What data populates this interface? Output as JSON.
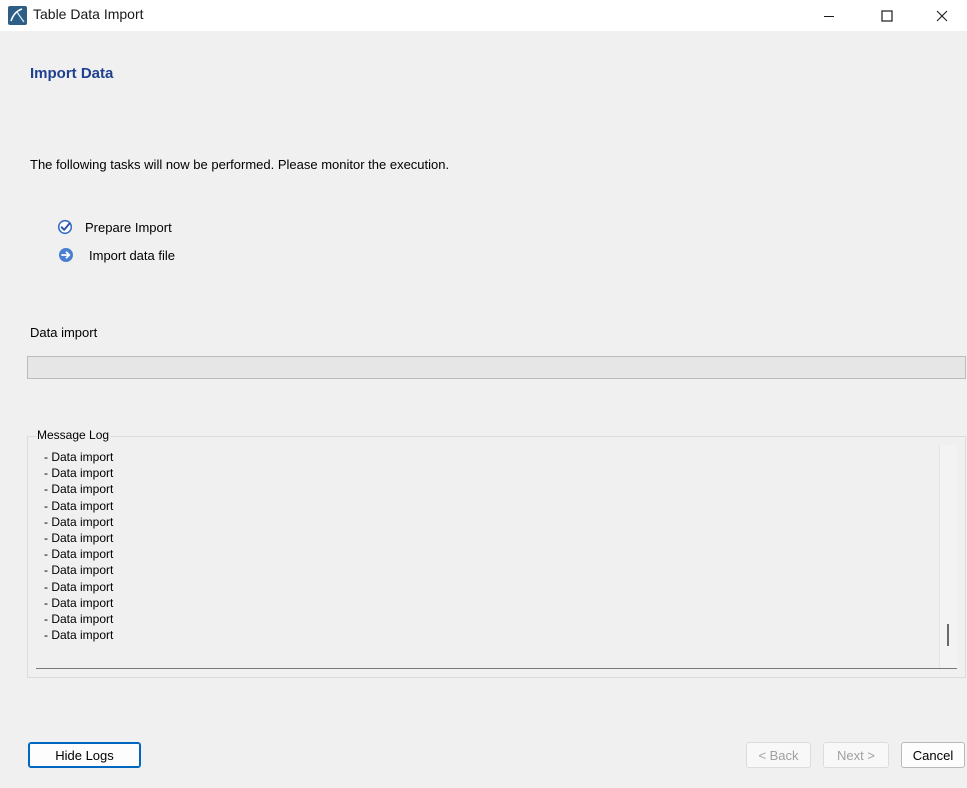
{
  "window": {
    "title": "Table Data Import",
    "app_icon": "mysql-workbench-icon",
    "controls": [
      "minimize-icon",
      "maximize-icon",
      "close-icon"
    ]
  },
  "page": {
    "heading": "Import Data",
    "intro": "The following tasks will now be performed. Please monitor the execution.",
    "tasks": [
      {
        "label": "Prepare Import",
        "status": "done",
        "icon": "check-circle-icon"
      },
      {
        "label": "Import data file",
        "status": "in-progress",
        "icon": "arrow-right-circle-icon"
      }
    ]
  },
  "progress": {
    "label": "Data import",
    "value_percent": 0
  },
  "log": {
    "title": "Message Log",
    "lines": [
      "- Data import",
      "- Data import",
      "- Data import",
      "- Data import",
      "- Data import",
      "- Data import",
      "- Data import",
      "- Data import",
      "- Data import",
      "- Data import",
      "- Data import",
      "- Data import"
    ]
  },
  "buttons": {
    "hide_logs": "Hide Logs",
    "back": "< Back",
    "next": "Next >",
    "cancel": "Cancel"
  },
  "colors": {
    "heading": "#1f3f8f",
    "accent": "#0067c0",
    "task_icon": "#3a6fc4",
    "disabled_text": "#a0a0a0"
  }
}
